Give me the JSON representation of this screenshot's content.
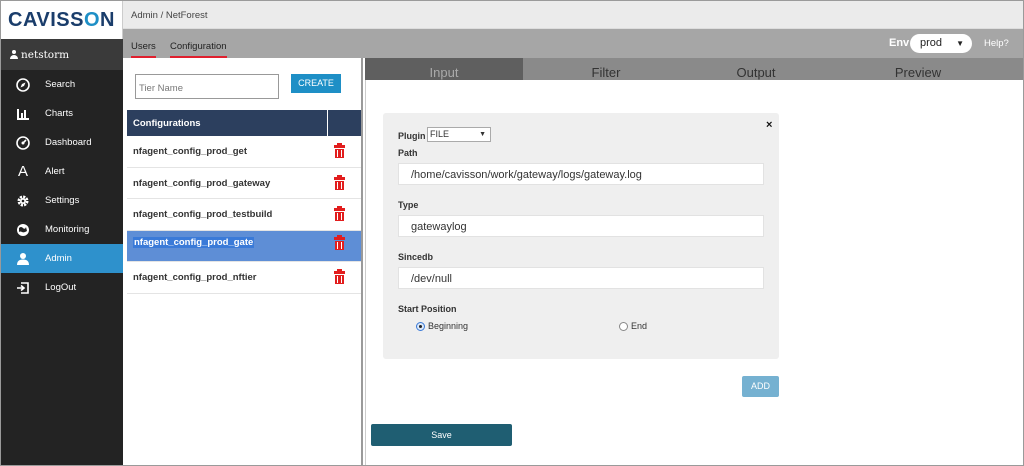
{
  "brand": {
    "logo_text_pre": "CAVISS",
    "logo_text_o": "O",
    "logo_text_post": "N"
  },
  "user": {
    "name": "netstorm"
  },
  "sidebar": {
    "items": [
      {
        "label": "Search",
        "icon": "compass-icon"
      },
      {
        "label": "Charts",
        "icon": "bar-chart-icon"
      },
      {
        "label": "Dashboard",
        "icon": "dashboard-icon"
      },
      {
        "label": "Alert",
        "icon": "alert-icon"
      },
      {
        "label": "Settings",
        "icon": "gear-icon"
      },
      {
        "label": "Monitoring",
        "icon": "globe-icon"
      },
      {
        "label": "Admin",
        "icon": "user-icon",
        "active": true
      },
      {
        "label": "LogOut",
        "icon": "logout-icon"
      }
    ],
    "active_color": "#2e91cc"
  },
  "header": {
    "breadcrumb": "Admin / NetForest",
    "tabs": [
      {
        "label": "Users"
      },
      {
        "label": "Configuration"
      }
    ],
    "env_label": "Env",
    "env_value": "prod",
    "help_label": "Help?"
  },
  "left": {
    "tier_placeholder": "Tier Name",
    "create_label": "CREATE",
    "table_header": "Configurations",
    "configs": [
      {
        "name": "nfagent_config_prod_get"
      },
      {
        "name": "nfagent_config_prod_gateway"
      },
      {
        "name": "nfagent_config_prod_testbuild"
      },
      {
        "name": "nfagent_config_prod_gate",
        "selected": true
      },
      {
        "name": "nfagent_config_prod_nftier"
      }
    ]
  },
  "right": {
    "tabs": [
      {
        "label": "Input",
        "active": true
      },
      {
        "label": "Filter"
      },
      {
        "label": "Output"
      },
      {
        "label": "Preview"
      }
    ],
    "form": {
      "plugin_label": "Plugin",
      "plugin_value": "FILE",
      "path_label": "Path",
      "path_value": "/home/cavisson/work/gateway/logs/gateway.log",
      "type_label": "Type",
      "type_value": "gatewaylog",
      "sincedb_label": "Sincedb",
      "sincedb_value": "/dev/null",
      "start_label": "Start Position",
      "options": [
        {
          "label": "Beginning",
          "checked": true
        },
        {
          "label": "End",
          "checked": false
        }
      ],
      "close_symbol": "×"
    },
    "add_label": "ADD",
    "save_label": "Save"
  }
}
